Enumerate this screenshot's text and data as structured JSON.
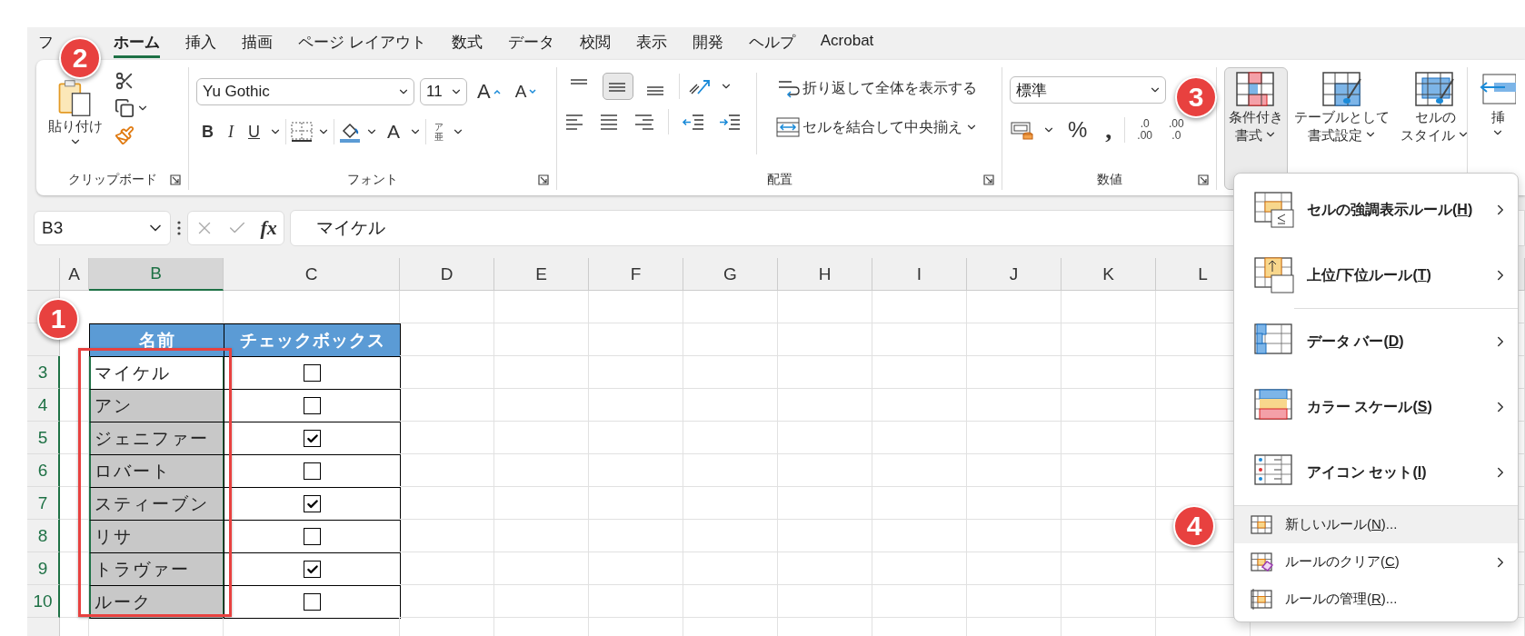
{
  "tabs": [
    {
      "label": "フ",
      "selected": false
    },
    {
      "label": "ホーム",
      "selected": true
    },
    {
      "label": "挿入",
      "selected": false
    },
    {
      "label": "描画",
      "selected": false
    },
    {
      "label": "ページ レイアウト",
      "selected": false
    },
    {
      "label": "数式",
      "selected": false
    },
    {
      "label": "データ",
      "selected": false
    },
    {
      "label": "校閲",
      "selected": false
    },
    {
      "label": "表示",
      "selected": false
    },
    {
      "label": "開発",
      "selected": false
    },
    {
      "label": "ヘルプ",
      "selected": false
    },
    {
      "label": "Acrobat",
      "selected": false
    }
  ],
  "ribbon": {
    "clipboard": {
      "paste_label": "貼り付け",
      "group_label": "クリップボード"
    },
    "font": {
      "font_name": "Yu Gothic",
      "font_size": "11",
      "grow_label": "A",
      "shrink_label": "A",
      "bold": "B",
      "italic": "I",
      "underline": "U",
      "color_label": "A",
      "phonetic_top": "ア",
      "phonetic_bottom": "亜",
      "group_label": "フォント"
    },
    "alignment": {
      "vertical": [
        {
          "selected": false
        },
        {
          "selected": true
        },
        {
          "selected": false
        }
      ],
      "wrap_text": "折り返して全体を表示する",
      "merge": "セルを結合して中央揃え",
      "group_label": "配置"
    },
    "number": {
      "format": "標準",
      "percent": "%",
      "comma": ",",
      "increase_decimal": {
        "top": ".0",
        "bottom": ".00"
      },
      "decrease_decimal": {
        "top": ".00",
        "bottom": ".0"
      },
      "group_label": "数値"
    },
    "styles": [
      {
        "lines": [
          "条件付き",
          "書式"
        ],
        "selected": true
      },
      {
        "lines": [
          "テーブルとして",
          "書式設定"
        ],
        "selected": false
      },
      {
        "lines": [
          "セルの",
          "スタイル"
        ],
        "selected": false
      }
    ],
    "insert": {
      "label": "挿"
    }
  },
  "formula_bar": {
    "name_box": "B3",
    "fx": "fx",
    "value": "マイケル"
  },
  "sheet": {
    "columns": [
      {
        "label": "A",
        "selected": false
      },
      {
        "label": "B",
        "selected": true
      },
      {
        "label": "C",
        "selected": false
      },
      {
        "label": "D",
        "selected": false
      },
      {
        "label": "E",
        "selected": false
      },
      {
        "label": "F",
        "selected": false
      },
      {
        "label": "G",
        "selected": false
      },
      {
        "label": "H",
        "selected": false
      },
      {
        "label": "I",
        "selected": false
      },
      {
        "label": "J",
        "selected": false
      },
      {
        "label": "K",
        "selected": false
      },
      {
        "label": "L",
        "selected": false
      }
    ],
    "row_numbers": [
      {
        "selected": false
      },
      {
        "selected": false
      },
      {
        "label": "3",
        "selected": true
      },
      {
        "label": "4",
        "selected": true
      },
      {
        "label": "5",
        "selected": true
      },
      {
        "label": "6",
        "selected": true
      },
      {
        "label": "7",
        "selected": true
      },
      {
        "label": "8",
        "selected": true
      },
      {
        "label": "9",
        "selected": true
      },
      {
        "label": "10",
        "selected": true
      },
      {
        "selected": false
      }
    ],
    "table": {
      "headers": [
        "名前",
        "チェックボックス"
      ],
      "rows": [
        {
          "name": "マイケル",
          "checked": false,
          "selected": true,
          "active": true
        },
        {
          "name": "アン",
          "checked": false,
          "selected": true,
          "active": false
        },
        {
          "name": "ジェニファー",
          "checked": true,
          "selected": true,
          "active": false
        },
        {
          "name": "ロバート",
          "checked": false,
          "selected": true,
          "active": false
        },
        {
          "name": "スティーブン",
          "checked": true,
          "selected": true,
          "active": false
        },
        {
          "name": "リサ",
          "checked": false,
          "selected": true,
          "active": false
        },
        {
          "name": "トラヴァー",
          "checked": true,
          "selected": true,
          "active": false
        },
        {
          "name": "ルーク",
          "checked": false,
          "selected": true,
          "active": false
        }
      ]
    }
  },
  "menu": {
    "items": [
      {
        "kind": "large",
        "before": "セルの強調表示ルール(",
        "key": "H",
        "after": ")",
        "submenu": true,
        "selected": false,
        "separator_before": false
      },
      {
        "kind": "large",
        "before": "上位/下位ルール(",
        "key": "T",
        "after": ")",
        "submenu": true,
        "selected": false,
        "separator_before": false
      },
      {
        "kind": "large",
        "before": "データ バー(",
        "key": "D",
        "after": ")",
        "submenu": true,
        "selected": false,
        "separator_before": true
      },
      {
        "kind": "large",
        "before": "カラー スケール(",
        "key": "S",
        "after": ")",
        "submenu": true,
        "selected": false,
        "separator_before": false
      },
      {
        "kind": "large",
        "before": "アイコン セット(",
        "key": "I",
        "after": ")",
        "submenu": true,
        "selected": false,
        "separator_before": false
      },
      {
        "kind": "small",
        "before": "新しいルール(",
        "key": "N",
        "after": ")...",
        "submenu": false,
        "selected": true,
        "separator_before": true
      },
      {
        "kind": "small",
        "before": "ルールのクリア(",
        "key": "C",
        "after": ")",
        "submenu": true,
        "selected": false,
        "separator_before": false
      },
      {
        "kind": "small",
        "before": "ルールの管理(",
        "key": "R",
        "after": ")...",
        "submenu": false,
        "selected": false,
        "separator_before": false
      }
    ]
  },
  "badges": [
    {
      "label": "1"
    },
    {
      "label": "2"
    },
    {
      "label": "3"
    },
    {
      "label": "4"
    }
  ]
}
